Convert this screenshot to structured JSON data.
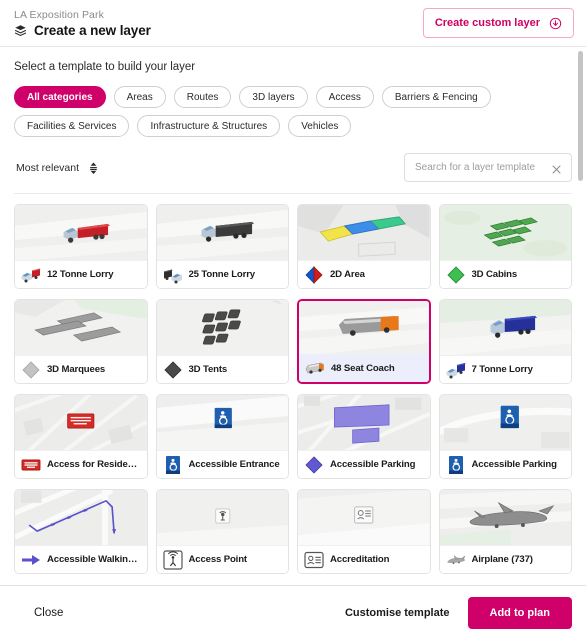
{
  "header": {
    "breadcrumb": "LA Exposition Park",
    "title": "Create a new layer",
    "layers_icon": "layers-icon",
    "custom_layer_button": {
      "label": "Create custom layer",
      "icon": "circle-pin-icon"
    }
  },
  "main": {
    "section_label": "Select a template to build your layer",
    "chips": [
      {
        "label": "All categories",
        "active": true
      },
      {
        "label": "Areas",
        "active": false
      },
      {
        "label": "Routes",
        "active": false
      },
      {
        "label": "3D layers",
        "active": false
      },
      {
        "label": "Access",
        "active": false
      },
      {
        "label": "Barriers & Fencing",
        "active": false
      },
      {
        "label": "Facilities & Services",
        "active": false
      },
      {
        "label": "Infrastructure & Structures",
        "active": false
      },
      {
        "label": "Vehicles",
        "active": false
      }
    ],
    "sort": {
      "value": "Most relevant",
      "icon": "sort-arrows-icon"
    },
    "search": {
      "value": "",
      "placeholder": "Search for a layer template",
      "clear_icon": "close-icon"
    },
    "cards": [
      {
        "title": "12 Tonne Lorry",
        "icon": "lorry-red-icon",
        "preview": "lorry-red",
        "selected": false
      },
      {
        "title": "25 Tonne Lorry",
        "icon": "lorry-black-icon",
        "preview": "lorry-black",
        "selected": false
      },
      {
        "title": "2D Area",
        "icon": "diamond-redblue-icon",
        "preview": "area-2d",
        "selected": false
      },
      {
        "title": "3D Cabins",
        "icon": "diamond-green-icon",
        "preview": "cabins-3d",
        "selected": false
      },
      {
        "title": "3D Marquees",
        "icon": "diamond-lightgrey-icon",
        "preview": "marquees-3d",
        "selected": false
      },
      {
        "title": "3D Tents",
        "icon": "diamond-darkgrey-icon",
        "preview": "tents-3d",
        "selected": false
      },
      {
        "title": "48 Seat Coach",
        "icon": "coach-icon",
        "preview": "coach",
        "selected": true
      },
      {
        "title": "7 Tonne Lorry",
        "icon": "lorry-blue-icon",
        "preview": "lorry-blue",
        "selected": false
      },
      {
        "title": "Access for Resident…",
        "icon": "sign-red-icon",
        "preview": "sign-red-map",
        "selected": false
      },
      {
        "title": "Accessible Entrance",
        "icon": "sign-accessible-icon",
        "preview": "sign-entrance",
        "selected": false
      },
      {
        "title": "Accessible Parking",
        "icon": "diamond-purple-icon",
        "preview": "parking-area",
        "selected": false
      },
      {
        "title": "Accessible Parking",
        "icon": "sign-accessible-icon",
        "preview": "sign-parking",
        "selected": false
      },
      {
        "title": "Accessible Walking …",
        "icon": "arrow-purple-icon",
        "preview": "walking-route",
        "selected": false
      },
      {
        "title": "Access Point",
        "icon": "antenna-icon",
        "preview": "access-point",
        "selected": false
      },
      {
        "title": "Accreditation",
        "icon": "badge-icon",
        "preview": "accreditation",
        "selected": false
      },
      {
        "title": "Airplane (737)",
        "icon": "airplane-icon",
        "preview": "airplane",
        "selected": false
      }
    ]
  },
  "footer": {
    "close_label": "Close",
    "customise_label": "Customise template",
    "add_label": "Add to plan"
  },
  "colors": {
    "accent_pink": "#d0006b",
    "accent_pink_light": "#f4a9c8",
    "selected_label_bg": "#eceefb",
    "card_border": "#e3e3e3",
    "text_primary": "#1b1b1b",
    "text_muted": "#8a8a8a"
  }
}
